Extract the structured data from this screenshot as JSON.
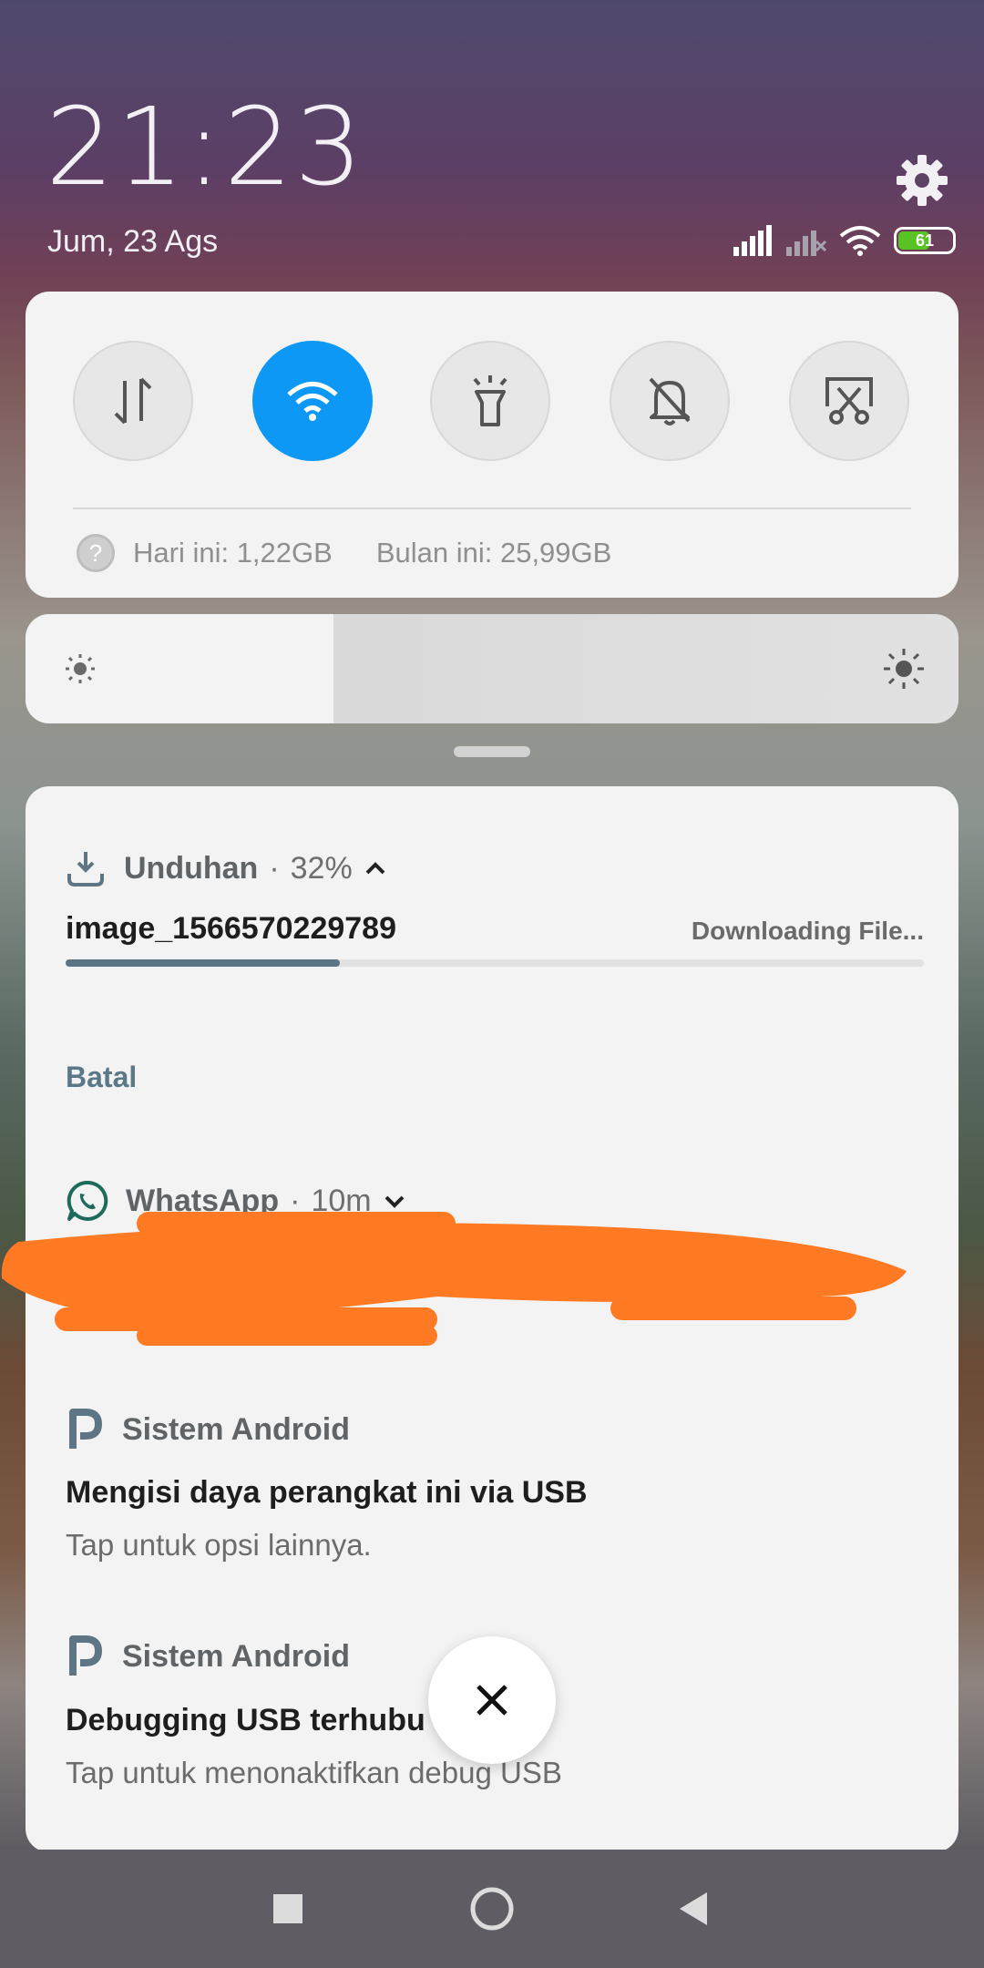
{
  "status": {
    "time": "21:23",
    "date": "Jum, 23 Ags",
    "battery": "61",
    "icons": [
      "signal-icon",
      "signal-off-icon",
      "wifi-icon",
      "battery-icon"
    ]
  },
  "quick_settings": {
    "toggles": [
      {
        "icon": "mobile-data-icon",
        "active": false
      },
      {
        "icon": "wifi-icon",
        "active": true
      },
      {
        "icon": "flashlight-icon",
        "active": false
      },
      {
        "icon": "mute-bell-icon",
        "active": false
      },
      {
        "icon": "screenshot-icon",
        "active": false
      }
    ],
    "usage_today": "Hari ini: 1,22GB",
    "usage_month": "Bulan ini: 25,99GB",
    "help_glyph": "?"
  },
  "brightness": {
    "level": 0.33
  },
  "notifications": {
    "download": {
      "app": "Unduhan",
      "percent": "32%",
      "progress": 0.32,
      "file": "image_1566570229789",
      "status": "Downloading File...",
      "action": "Batal"
    },
    "whatsapp": {
      "app": "WhatsApp",
      "time": "10m"
    },
    "android1": {
      "app": "Sistem Android",
      "title": "Mengisi daya perangkat ini via USB",
      "text": "Tap untuk opsi lainnya."
    },
    "android2": {
      "app": "Sistem Android",
      "title": "Debugging USB terhubu",
      "text": "Tap untuk menonaktifkan debug USB"
    }
  },
  "colors": {
    "accent": "#0d98f5",
    "redaction": "#ff7a22"
  }
}
